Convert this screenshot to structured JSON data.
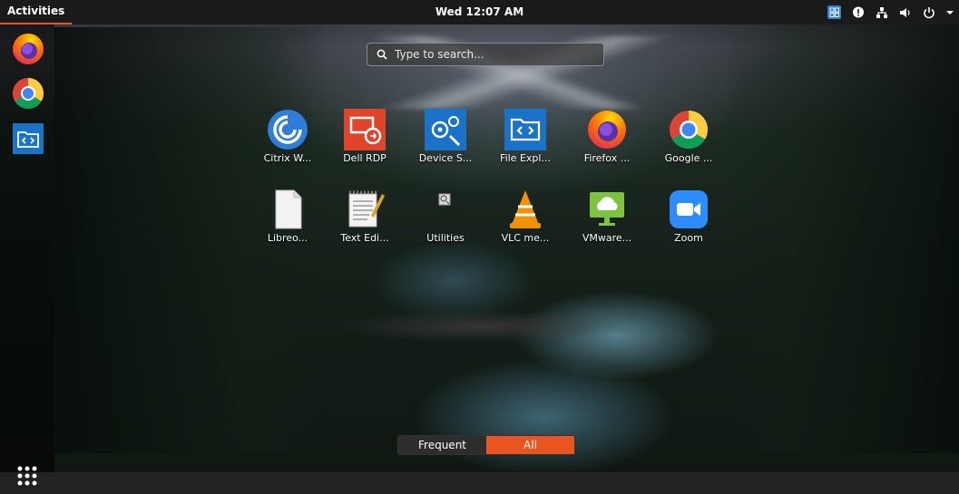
{
  "topbar": {
    "activities": "Activities",
    "clock": "Wed 12:07 AM"
  },
  "tray": {
    "icons": [
      "app-indicator-icon",
      "notification-icon",
      "network-icon",
      "volume-icon",
      "power-icon",
      "menu-arrow-icon"
    ],
    "accent": "#2a7de1"
  },
  "dock": {
    "items": [
      "firefox",
      "google-chrome",
      "file-explorer"
    ]
  },
  "search": {
    "placeholder": "Type to search..."
  },
  "apps": [
    {
      "label": "Citrix W...",
      "icon": "citrix-icon"
    },
    {
      "label": "Dell RDP",
      "icon": "dell-rdp-icon"
    },
    {
      "label": "Device S...",
      "icon": "device-settings-icon"
    },
    {
      "label": "File Expl...",
      "icon": "file-explorer-icon"
    },
    {
      "label": "Firefox ...",
      "icon": "firefox-icon"
    },
    {
      "label": "Google ...",
      "icon": "chrome-icon"
    },
    {
      "label": "Libreo...",
      "icon": "libreoffice-icon"
    },
    {
      "label": "Text Edi...",
      "icon": "text-editor-icon"
    },
    {
      "label": "Utilities",
      "icon": "utilities-icon"
    },
    {
      "label": "VLC me...",
      "icon": "vlc-icon"
    },
    {
      "label": "VMware...",
      "icon": "vmware-icon"
    },
    {
      "label": "Zoom",
      "icon": "zoom-icon"
    }
  ],
  "switcher": {
    "frequent": "Frequent",
    "all": "All",
    "active": "All",
    "accent": "#e95420"
  },
  "colors": {
    "topbar": "#1a1a1a",
    "accent": "#e95420"
  }
}
